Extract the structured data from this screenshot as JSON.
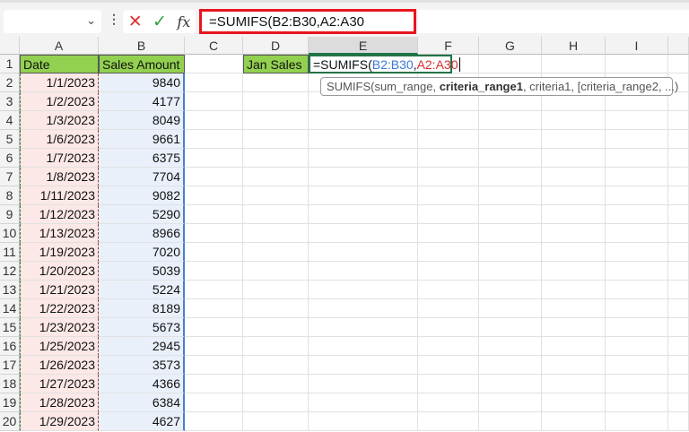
{
  "formula_bar": {
    "name_box": "",
    "formula": "=SUMIFS(B2:B30,A2:A30",
    "cancel_icon": "✕",
    "enter_icon": "✓",
    "fx_label": "fx"
  },
  "columns": [
    "A",
    "B",
    "C",
    "D",
    "E",
    "F",
    "G",
    "H",
    "I"
  ],
  "header": {
    "date": "Date",
    "amount": "Sales Amount",
    "label": "Jan Sales"
  },
  "edit": {
    "prefix": "=SUMIFS(",
    "range1": "B2:B30",
    "comma": ",",
    "range2": "A2:A30"
  },
  "tooltip": {
    "fn": "SUMIFS(sum_range, ",
    "bold": "criteria_range1",
    "rest": ", criteria1, [criteria_range2, ...)"
  },
  "rows": [
    {
      "n": "1"
    },
    {
      "n": "2",
      "date": "1/1/2023",
      "amt": "9840"
    },
    {
      "n": "3",
      "date": "1/2/2023",
      "amt": "4177"
    },
    {
      "n": "4",
      "date": "1/3/2023",
      "amt": "8049"
    },
    {
      "n": "5",
      "date": "1/6/2023",
      "amt": "9661"
    },
    {
      "n": "6",
      "date": "1/7/2023",
      "amt": "6375"
    },
    {
      "n": "7",
      "date": "1/8/2023",
      "amt": "7704"
    },
    {
      "n": "8",
      "date": "1/11/2023",
      "amt": "9082"
    },
    {
      "n": "9",
      "date": "1/12/2023",
      "amt": "5290"
    },
    {
      "n": "10",
      "date": "1/13/2023",
      "amt": "8966"
    },
    {
      "n": "11",
      "date": "1/19/2023",
      "amt": "7020"
    },
    {
      "n": "12",
      "date": "1/20/2023",
      "amt": "5039"
    },
    {
      "n": "13",
      "date": "1/21/2023",
      "amt": "5224"
    },
    {
      "n": "14",
      "date": "1/22/2023",
      "amt": "8189"
    },
    {
      "n": "15",
      "date": "1/23/2023",
      "amt": "5673"
    },
    {
      "n": "16",
      "date": "1/25/2023",
      "amt": "2945"
    },
    {
      "n": "17",
      "date": "1/26/2023",
      "amt": "3573"
    },
    {
      "n": "18",
      "date": "1/27/2023",
      "amt": "4366"
    },
    {
      "n": "19",
      "date": "1/28/2023",
      "amt": "6384"
    },
    {
      "n": "20",
      "date": "1/29/2023",
      "amt": "4627"
    }
  ]
}
